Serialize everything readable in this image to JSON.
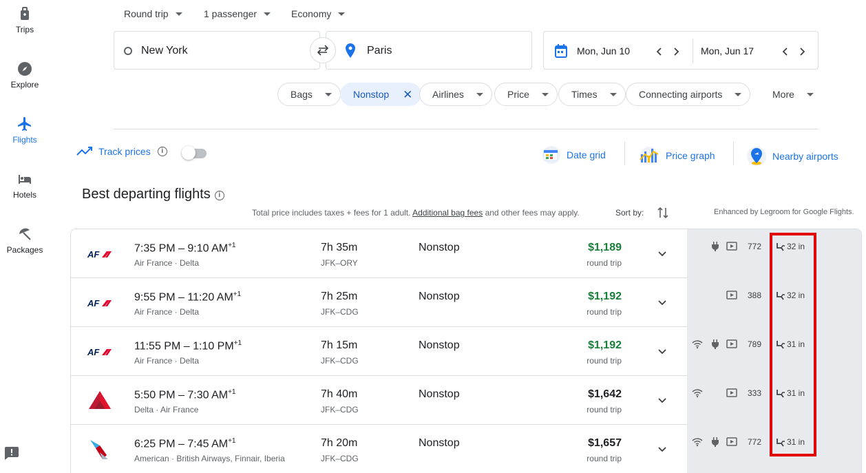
{
  "rail": [
    {
      "label": "Trips"
    },
    {
      "label": "Explore"
    },
    {
      "label": "Flights"
    },
    {
      "label": "Hotels"
    },
    {
      "label": "Packages"
    }
  ],
  "search": {
    "trip_type": "Round trip",
    "passengers": "1 passenger",
    "cabin": "Economy",
    "origin": "New York",
    "destination": "Paris",
    "depart": "Mon, Jun 10",
    "return": "Mon, Jun 17"
  },
  "filters": {
    "bags": "Bags",
    "nonstop": "Nonstop",
    "airlines": "Airlines",
    "price": "Price",
    "times": "Times",
    "connecting": "Connecting airports",
    "more": "More"
  },
  "tools": {
    "track_prices": "Track prices",
    "date_grid": "Date grid",
    "price_graph": "Price graph",
    "nearby": "Nearby airports"
  },
  "section": {
    "title": "Best departing flights",
    "note_pre": "Total price includes taxes + fees for 1 adult.",
    "note_link": "Additional bag fees",
    "note_post": "and other fees may apply.",
    "sort_by": "Sort by:",
    "enhanced": "Enhanced by Legroom for Google Flights."
  },
  "accent": "#1a73e8",
  "low_price_color": "#188038",
  "highlight_color": "#e30000",
  "flights": [
    {
      "times": "7:35 PM – 9:10 AM",
      "plus": "+1",
      "airlines": "Air France · Delta",
      "duration": "7h 35m",
      "route": "JFK–ORY",
      "stops": "Nonstop",
      "price": "$1,189",
      "ptype": "round trip",
      "co2": "772",
      "legroom": "32 in",
      "logo": "af"
    },
    {
      "times": "9:55 PM – 11:20 AM",
      "plus": "+1",
      "airlines": "Air France · Delta",
      "duration": "7h 25m",
      "route": "JFK–CDG",
      "stops": "Nonstop",
      "price": "$1,192",
      "ptype": "round trip",
      "co2": "388",
      "legroom": "32 in",
      "logo": "af"
    },
    {
      "times": "11:55 PM – 1:10 PM",
      "plus": "+1",
      "airlines": "Air France · Delta",
      "duration": "7h 15m",
      "route": "JFK–CDG",
      "stops": "Nonstop",
      "price": "$1,192",
      "ptype": "round trip",
      "co2": "789",
      "legroom": "31 in",
      "logo": "af"
    },
    {
      "times": "5:50 PM – 7:30 AM",
      "plus": "+1",
      "airlines": "Delta · Air France",
      "duration": "7h 40m",
      "route": "JFK–CDG",
      "stops": "Nonstop",
      "price": "$1,642",
      "ptype": "round trip",
      "co2": "333",
      "legroom": "31 in",
      "logo": "delta"
    },
    {
      "times": "6:25 PM – 7:45 AM",
      "plus": "+1",
      "airlines": "American · British Airways, Finnair, Iberia",
      "duration": "7h 20m",
      "route": "JFK–CDG",
      "stops": "Nonstop",
      "price": "$1,657",
      "ptype": "round trip",
      "co2": "772",
      "legroom": "31 in",
      "logo": "aa"
    }
  ],
  "logos": {
    "af": "AF"
  }
}
